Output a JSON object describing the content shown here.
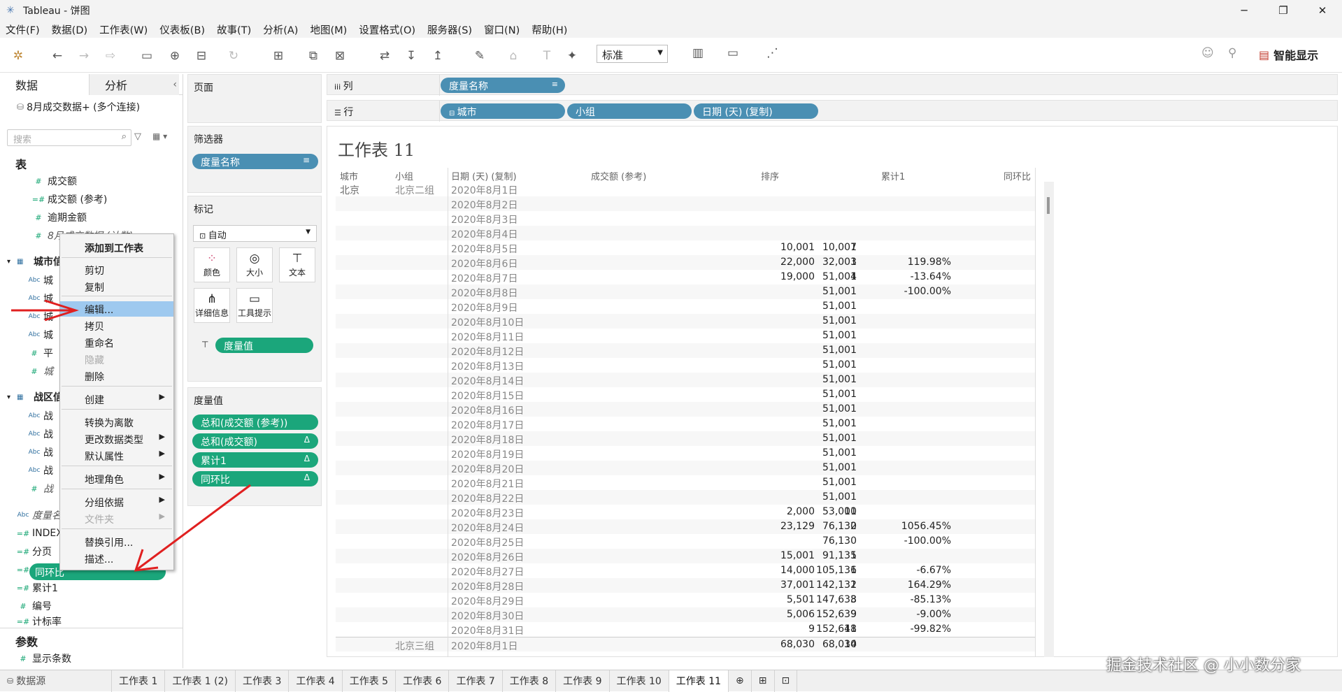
{
  "window": {
    "title": "Tableau - 饼图"
  },
  "menu": [
    "文件(F)",
    "数据(D)",
    "工作表(W)",
    "仪表板(B)",
    "故事(T)",
    "分析(A)",
    "地图(M)",
    "设置格式(O)",
    "服务器(S)",
    "窗口(N)",
    "帮助(H)"
  ],
  "toolbar": {
    "fit_select": "标准",
    "smart_display": "智能显示"
  },
  "datapane": {
    "tab_data": "数据",
    "tab_analysis": "分析",
    "connection": "8月成交数据+ (多个连接)",
    "search_placeholder": "搜索",
    "section_tables": "表",
    "section_params": "参数",
    "fields": [
      {
        "label": "成交额"
      },
      {
        "label": "成交额 (参考)"
      },
      {
        "label": "逾期金额"
      },
      {
        "label": "8月成交数据 (计数)"
      },
      {
        "label": "城市信息"
      },
      {
        "label": "城"
      },
      {
        "label": "城"
      },
      {
        "label": "城"
      },
      {
        "label": "城"
      },
      {
        "label": "平"
      },
      {
        "label": "城"
      },
      {
        "label": "战区信息"
      },
      {
        "label": "战"
      },
      {
        "label": "战"
      },
      {
        "label": "战"
      },
      {
        "label": "战"
      },
      {
        "label": "战"
      },
      {
        "label": "度量名称"
      },
      {
        "label": "INDEX"
      },
      {
        "label": "分页"
      },
      {
        "label": "同环比"
      },
      {
        "label": "累计1"
      },
      {
        "label": "编号"
      },
      {
        "label": "计标率"
      },
      {
        "label": "显示条数"
      }
    ]
  },
  "context_menu": {
    "items": [
      "添加到工作表",
      "剪切",
      "复制",
      "编辑...",
      "拷贝",
      "重命名",
      "隐藏",
      "删除",
      "创建",
      "转换为离散",
      "更改数据类型",
      "默认属性",
      "地理角色",
      "分组依据",
      "文件夹",
      "替换引用...",
      "描述..."
    ]
  },
  "shelves": {
    "pages": "页面",
    "filters": "筛选器",
    "filter_pill": "度量名称",
    "marks": "标记",
    "marks_type": "自动",
    "mark_buttons": [
      "颜色",
      "大小",
      "文本",
      "详细信息",
      "工具提示"
    ],
    "text_pill": "度量值",
    "measure_values": "度量值",
    "mv_pills": [
      "总和(成交额 (参考))",
      "总和(成交额)",
      "累计1",
      "同环比"
    ],
    "columns_label": "列",
    "rows_label": "行",
    "columns_pill": "度量名称",
    "rows_pills": [
      "城市",
      "小组",
      "日期 (天) (复制)"
    ]
  },
  "view": {
    "title": "工作表 11",
    "headers": [
      "城市",
      "小组",
      "日期 (天) (复制)",
      "成交额 (参考)",
      "排序",
      "累计1",
      "同环比"
    ],
    "rows": [
      {
        "city": "北京",
        "group": "北京二组",
        "date": "2020年8月1日",
        "amt": "",
        "rank": "",
        "cum": "",
        "hb": ""
      },
      {
        "city": "",
        "group": "",
        "date": "2020年8月2日",
        "amt": "",
        "rank": "",
        "cum": "",
        "hb": ""
      },
      {
        "city": "",
        "group": "",
        "date": "2020年8月3日",
        "amt": "",
        "rank": "",
        "cum": "",
        "hb": ""
      },
      {
        "city": "",
        "group": "",
        "date": "2020年8月4日",
        "amt": "",
        "rank": "",
        "cum": "",
        "hb": ""
      },
      {
        "city": "",
        "group": "",
        "date": "2020年8月5日",
        "amt": "10,001",
        "rank": "7",
        "cum": "10,001",
        "hb": ""
      },
      {
        "city": "",
        "group": "",
        "date": "2020年8月6日",
        "amt": "22,000",
        "rank": "3",
        "cum": "32,001",
        "hb": "119.98%"
      },
      {
        "city": "",
        "group": "",
        "date": "2020年8月7日",
        "amt": "19,000",
        "rank": "4",
        "cum": "51,001",
        "hb": "-13.64%"
      },
      {
        "city": "",
        "group": "",
        "date": "2020年8月8日",
        "amt": "",
        "rank": "",
        "cum": "51,001",
        "hb": "-100.00%"
      },
      {
        "city": "",
        "group": "",
        "date": "2020年8月9日",
        "amt": "",
        "rank": "",
        "cum": "51,001",
        "hb": ""
      },
      {
        "city": "",
        "group": "",
        "date": "2020年8月10日",
        "amt": "",
        "rank": "",
        "cum": "51,001",
        "hb": ""
      },
      {
        "city": "",
        "group": "",
        "date": "2020年8月11日",
        "amt": "",
        "rank": "",
        "cum": "51,001",
        "hb": ""
      },
      {
        "city": "",
        "group": "",
        "date": "2020年8月12日",
        "amt": "",
        "rank": "",
        "cum": "51,001",
        "hb": ""
      },
      {
        "city": "",
        "group": "",
        "date": "2020年8月13日",
        "amt": "",
        "rank": "",
        "cum": "51,001",
        "hb": ""
      },
      {
        "city": "",
        "group": "",
        "date": "2020年8月14日",
        "amt": "",
        "rank": "",
        "cum": "51,001",
        "hb": ""
      },
      {
        "city": "",
        "group": "",
        "date": "2020年8月15日",
        "amt": "",
        "rank": "",
        "cum": "51,001",
        "hb": ""
      },
      {
        "city": "",
        "group": "",
        "date": "2020年8月16日",
        "amt": "",
        "rank": "",
        "cum": "51,001",
        "hb": ""
      },
      {
        "city": "",
        "group": "",
        "date": "2020年8月17日",
        "amt": "",
        "rank": "",
        "cum": "51,001",
        "hb": ""
      },
      {
        "city": "",
        "group": "",
        "date": "2020年8月18日",
        "amt": "",
        "rank": "",
        "cum": "51,001",
        "hb": ""
      },
      {
        "city": "",
        "group": "",
        "date": "2020年8月19日",
        "amt": "",
        "rank": "",
        "cum": "51,001",
        "hb": ""
      },
      {
        "city": "",
        "group": "",
        "date": "2020年8月20日",
        "amt": "",
        "rank": "",
        "cum": "51,001",
        "hb": ""
      },
      {
        "city": "",
        "group": "",
        "date": "2020年8月21日",
        "amt": "",
        "rank": "",
        "cum": "51,001",
        "hb": ""
      },
      {
        "city": "",
        "group": "",
        "date": "2020年8月22日",
        "amt": "",
        "rank": "",
        "cum": "51,001",
        "hb": ""
      },
      {
        "city": "",
        "group": "",
        "date": "2020年8月23日",
        "amt": "2,000",
        "rank": "10",
        "cum": "53,001",
        "hb": ""
      },
      {
        "city": "",
        "group": "",
        "date": "2020年8月24日",
        "amt": "23,129",
        "rank": "2",
        "cum": "76,130",
        "hb": "1056.45%"
      },
      {
        "city": "",
        "group": "",
        "date": "2020年8月25日",
        "amt": "",
        "rank": "",
        "cum": "76,130",
        "hb": "-100.00%"
      },
      {
        "city": "",
        "group": "",
        "date": "2020年8月26日",
        "amt": "15,001",
        "rank": "5",
        "cum": "91,131",
        "hb": ""
      },
      {
        "city": "",
        "group": "",
        "date": "2020年8月27日",
        "amt": "14,000",
        "rank": "6",
        "cum": "105,131",
        "hb": "-6.67%"
      },
      {
        "city": "",
        "group": "",
        "date": "2020年8月28日",
        "amt": "37,001",
        "rank": "1",
        "cum": "142,132",
        "hb": "164.29%"
      },
      {
        "city": "",
        "group": "",
        "date": "2020年8月29日",
        "amt": "5,501",
        "rank": "8",
        "cum": "147,633",
        "hb": "-85.13%"
      },
      {
        "city": "",
        "group": "",
        "date": "2020年8月30日",
        "amt": "5,006",
        "rank": "9",
        "cum": "152,639",
        "hb": "-9.00%"
      },
      {
        "city": "",
        "group": "",
        "date": "2020年8月31日",
        "amt": "9",
        "rank": "11",
        "cum": "152,648",
        "hb": "-99.82%"
      },
      {
        "city": "",
        "group": "北京三组",
        "date": "2020年8月1日",
        "amt": "68,030",
        "rank": "14",
        "cum": "68,030",
        "hb": ""
      }
    ]
  },
  "bottom_tabs": {
    "datasource": "数据源",
    "sheets": [
      "工作表 1",
      "工作表 1 (2)",
      "工作表 3",
      "工作表 4",
      "工作表 5",
      "工作表 6",
      "工作表 7",
      "工作表 8",
      "工作表 9",
      "工作表 10",
      "工作表 11"
    ],
    "active": "工作表 11"
  },
  "watermark": "掘金技术社区 @ 小小数分家",
  "colors": {
    "green_pill": "#1ba67b",
    "blue_pill": "#4a8fb3",
    "highlight": "#9ec9ef",
    "arrow": "#e02020"
  }
}
